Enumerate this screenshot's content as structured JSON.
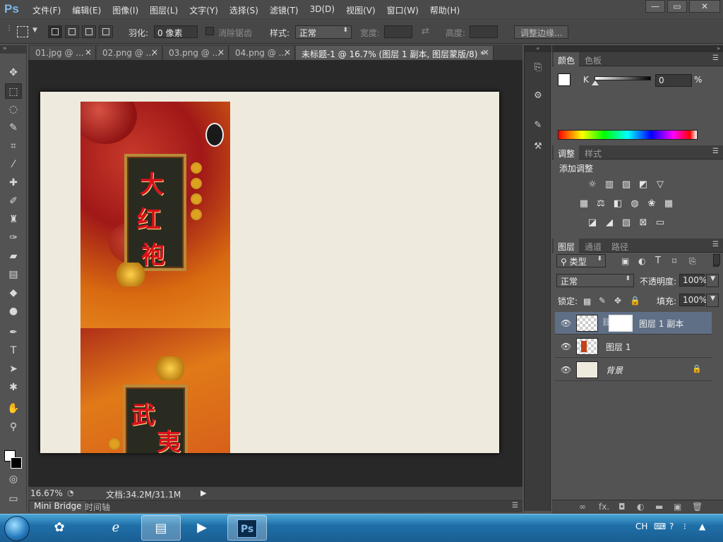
{
  "app": {
    "logo": "Ps"
  },
  "menu": [
    "文件(F)",
    "编辑(E)",
    "图像(I)",
    "图层(L)",
    "文字(Y)",
    "选择(S)",
    "滤镜(T)",
    "3D(D)",
    "视图(V)",
    "窗口(W)",
    "帮助(H)"
  ],
  "window_controls": {
    "minimize": "—",
    "restore": "▭",
    "close": "✕"
  },
  "options": {
    "feather_label": "羽化:",
    "feather_value": "0 像素",
    "antialias_label": "消除锯齿",
    "style_label": "样式:",
    "style_value": "正常",
    "width_label": "宽度:",
    "height_label": "高度:",
    "refine_edge_label": "调整边缘..."
  },
  "doc_tabs": [
    {
      "label": "01.jpg @ ...",
      "close": "×"
    },
    {
      "label": "02.png @ ...",
      "close": "×"
    },
    {
      "label": "03.png @ ...",
      "close": "×"
    },
    {
      "label": "04.png @ ...",
      "close": "×"
    },
    {
      "label": "未标题-1 @ 16.7% (图层 1 副本, 图层蒙版/8) *",
      "close": "×"
    }
  ],
  "artwork": {
    "chars_top": [
      "大",
      "红",
      "袍"
    ],
    "chars_bottom": [
      "武",
      "夷"
    ]
  },
  "status": {
    "zoom": "16.67%",
    "doc_info": "文档:34.2M/31.1M"
  },
  "bottom_tabs": [
    "Mini Bridge",
    "时间轴"
  ],
  "color_panel": {
    "tabs": [
      "颜色",
      "色板"
    ],
    "channel": "K",
    "value": "0",
    "unit": "%"
  },
  "adjust_panel": {
    "tabs": [
      "调整",
      "样式"
    ],
    "title": "添加调整"
  },
  "layers_panel": {
    "tabs": [
      "图层",
      "通道",
      "路径"
    ],
    "filter_value": "类型",
    "blend_value": "正常",
    "opacity_label": "不透明度:",
    "opacity_value": "100%",
    "lock_label": "锁定:",
    "fill_label": "填充:",
    "fill_value": "100%",
    "layers": [
      {
        "name": "图层 1 副本",
        "selected": true
      },
      {
        "name": "图层 1",
        "selected": false
      },
      {
        "name": "背景",
        "selected": false
      }
    ],
    "footer_icons": [
      "∞",
      "fx.",
      "◘",
      "◐",
      "▬",
      "▣",
      "🗑"
    ]
  },
  "taskbar": {
    "tray_lang": "CH"
  },
  "colors": {
    "accent": "#7fb7e6",
    "selected_layer": "#5f6f86",
    "doc_background": "#eeeade"
  }
}
